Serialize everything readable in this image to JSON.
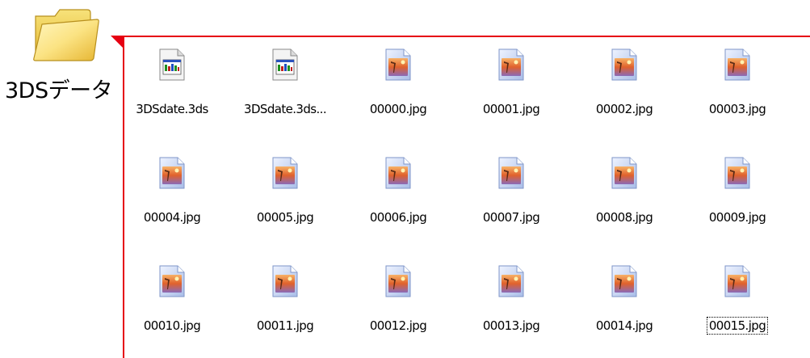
{
  "folder": {
    "label": "3DSデータ",
    "icon": "folder-icon"
  },
  "accent_color": "#e60012",
  "files": [
    {
      "name": "3DSdate.3ds",
      "icon": "3ds-file-icon"
    },
    {
      "name": "3DSdate.3ds...",
      "icon": "3ds-file-icon"
    },
    {
      "name": "00000.jpg",
      "icon": "jpg-file-icon"
    },
    {
      "name": "00001.jpg",
      "icon": "jpg-file-icon"
    },
    {
      "name": "00002.jpg",
      "icon": "jpg-file-icon"
    },
    {
      "name": "00003.jpg",
      "icon": "jpg-file-icon"
    },
    {
      "name": "00004.jpg",
      "icon": "jpg-file-icon"
    },
    {
      "name": "00005.jpg",
      "icon": "jpg-file-icon"
    },
    {
      "name": "00006.jpg",
      "icon": "jpg-file-icon"
    },
    {
      "name": "00007.jpg",
      "icon": "jpg-file-icon"
    },
    {
      "name": "00008.jpg",
      "icon": "jpg-file-icon"
    },
    {
      "name": "00009.jpg",
      "icon": "jpg-file-icon"
    },
    {
      "name": "00010.jpg",
      "icon": "jpg-file-icon"
    },
    {
      "name": "00011.jpg",
      "icon": "jpg-file-icon"
    },
    {
      "name": "00012.jpg",
      "icon": "jpg-file-icon"
    },
    {
      "name": "00013.jpg",
      "icon": "jpg-file-icon"
    },
    {
      "name": "00014.jpg",
      "icon": "jpg-file-icon"
    },
    {
      "name": "00015.jpg",
      "icon": "jpg-file-icon",
      "focused": true
    }
  ]
}
